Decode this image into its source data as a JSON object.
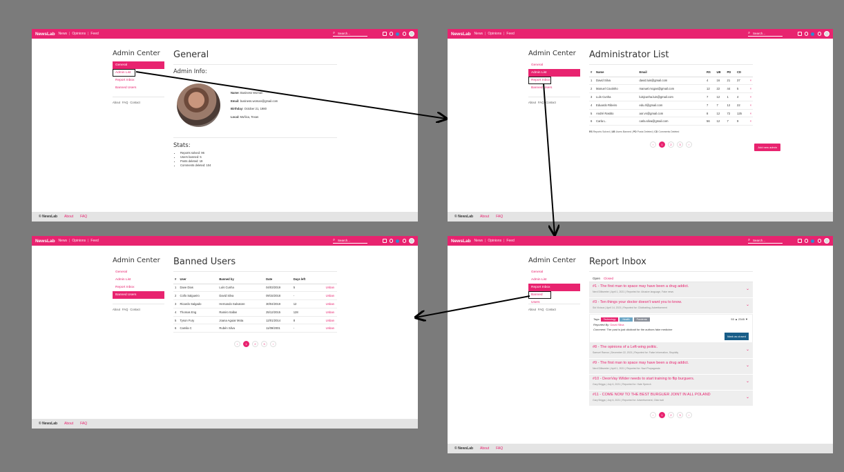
{
  "nav": {
    "brand": "NewsLab",
    "links": [
      "News",
      "Opinions",
      "Feed"
    ],
    "search_placeholder": "Search..."
  },
  "footer": {
    "brand": "© NewsLab",
    "links": [
      "About",
      "FAQ"
    ]
  },
  "sidebar": {
    "title": "Admin Center",
    "items": [
      "General",
      "Admin List",
      "Report Inbox",
      "Banned Users"
    ],
    "sub": [
      "About",
      "FAQ",
      "Contact"
    ]
  },
  "general": {
    "title": "General",
    "admin_info_heading": "Admin Info:",
    "name_label": "Name:",
    "name": "Business Woman",
    "email_label": "Email:",
    "email": "business.woman@gmail.com",
    "birthday_label": "Birthday:",
    "birthday": "October 21, 1980",
    "local_label": "Local:",
    "local": "Muñica, Texas",
    "stats_heading": "Stats:",
    "stats": [
      "Reports solved: 96",
      "Users banned: 5",
      "Posts deleted: 19",
      "Comments deleted: 104"
    ]
  },
  "admin_list": {
    "title": "Administrator List",
    "headers": [
      "#",
      "Name",
      "Email",
      "RS",
      "UB",
      "PD",
      "CD"
    ],
    "rows": [
      [
        "1",
        "David Silva",
        "david.luis@gmail.com",
        "4",
        "16",
        "21",
        "37"
      ],
      [
        "2",
        "Manuel Coutinho",
        "manuel.mcgas@gmail.com",
        "12",
        "22",
        "44",
        "5"
      ],
      [
        "3",
        "Luís Cunha",
        "luisjcunha.luis@gmail.com",
        "7",
        "12",
        "1",
        "4"
      ],
      [
        "4",
        "Eduardo Ribeiro",
        "edu.rl@gmail.com",
        "7",
        "7",
        "12",
        "22"
      ],
      [
        "5",
        "André Rastito",
        "aor.vn@gmail.com",
        "8",
        "12",
        "72",
        "125"
      ],
      [
        "6",
        "Carla L.",
        "carla.silva@gmail.com",
        "56",
        "12",
        "7",
        "9"
      ]
    ],
    "remove_symbol": "×",
    "legend": [
      [
        "RS",
        "Reports Solved"
      ],
      [
        "UB",
        "Users Banned"
      ],
      [
        "PD",
        "Posts Deleted"
      ],
      [
        "CD",
        "Comments Deleted"
      ]
    ],
    "add_button": "Add new admin",
    "pages": [
      "‹",
      "1",
      "2",
      "3",
      "›"
    ]
  },
  "banned": {
    "title": "Banned Users",
    "headers": [
      "#",
      "User",
      "Banned by",
      "Date",
      "Days left",
      ""
    ],
    "rows": [
      [
        "1",
        "Dave Dias",
        "Luís Cunha",
        "04/03/2019",
        "5"
      ],
      [
        "2",
        "Collo Salgueiro",
        "David Silva",
        "09/15/2018",
        "-"
      ],
      [
        "3",
        "Ricardo Salgado",
        "Hernando Salvatore",
        "30/04/2019",
        "12"
      ],
      [
        "4",
        "Thomas Eng",
        "Ramiro Itallan",
        "25/12/2015",
        "128"
      ],
      [
        "5",
        "Tyson Fury",
        "Joana Aguiar Mota",
        "12/01/2014",
        "8"
      ],
      [
        "6",
        "Camila C",
        "Rubén Silva",
        "11/09/2001",
        "-"
      ]
    ],
    "action": "Unban",
    "pages": [
      "‹",
      "1",
      "2",
      "3",
      "›"
    ]
  },
  "inbox": {
    "title": "Report Inbox",
    "tabs": [
      "Open",
      "Closed"
    ],
    "reports": [
      {
        "t": "#1 - The first man to space may have been a drug addict.",
        "m": "Nerd Dillweeter  |  April 1, 2021  |  Reported for: Abusive language, Fake news"
      },
      {
        "t": "#3 - Ten things your doctor doesn't want you to know.",
        "m": "Sid Vicious  |  April 14, 2021  |  Reported for: Clickbaiting, Advertisement"
      },
      {
        "t": "#8 - The opinions of a Left-wing politic.",
        "m": "Samuel Ramos  |  December 22, 2021  |  Reported for: False Information, Stupidity"
      },
      {
        "t": "#9 - The first man to space may have been a drug addict.",
        "m": "Nerd Dillweeter  |  April 1, 2021  |  Reported for: Nazi Propaganda"
      },
      {
        "t": "#10 - DeonVay Wilder needs to start training to flip burguers.",
        "m": "Gary Briggs  |  July 6, 2021  |  Reported for: Hate Speech"
      },
      {
        "t": "#11 - COME NOW TO THE BEST BURGUER JOINT IN ALL POLAND",
        "m": "Gary Briggs  |  July 6, 2021  |  Reported for: Advertisement, Click bait"
      }
    ],
    "expanded": {
      "tags_label": "Tags:",
      "tags": [
        "Technology",
        "Health",
        "Pandemic"
      ],
      "tag_colors": [
        "#e8236f",
        "#6aa6c6",
        "#8a8f99"
      ],
      "votes": "53 ▲  2345 ▼",
      "reported_by_label": "Reported By:",
      "reported_by": "David Silva",
      "comment_label": "Comment:",
      "comment": "The post is just clickbait for the authors fake medicine",
      "button": "Mark as closed"
    },
    "pages": [
      "‹",
      "1",
      "2",
      "3",
      "›"
    ]
  }
}
